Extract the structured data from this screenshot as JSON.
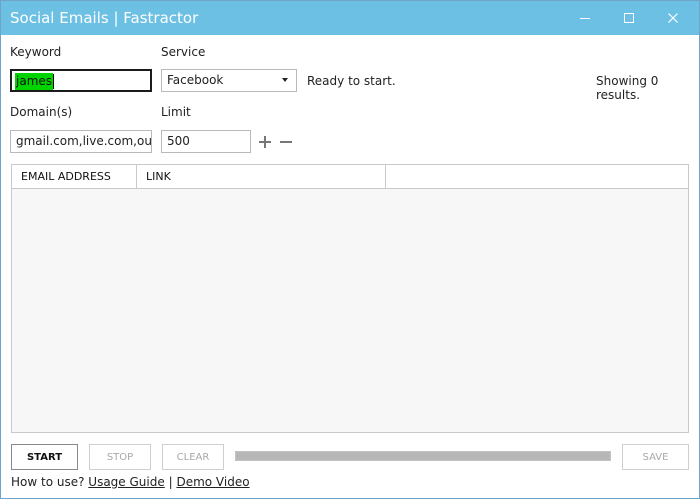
{
  "window": {
    "title": "Social Emails | Fastractor",
    "controls": {
      "minimize": "–",
      "maximize": "☐",
      "close": "✕"
    }
  },
  "form": {
    "keyword_label": "Keyword",
    "keyword_value": "james",
    "service_label": "Service",
    "service_value": "Facebook",
    "domains_label": "Domain(s)",
    "domains_value": "gmail.com,live.com,outlo",
    "limit_label": "Limit",
    "limit_value": "500"
  },
  "status": {
    "message": "Ready to start.",
    "results": "Showing 0 results."
  },
  "table": {
    "columns": [
      "EMAIL ADDRESS",
      "LINK",
      ""
    ],
    "rows": []
  },
  "buttons": {
    "start": "START",
    "stop": "STOP",
    "clear": "CLEAR",
    "save": "SAVE"
  },
  "progress": {
    "value": 1.0
  },
  "footer": {
    "prefix": "How to use?",
    "usage_guide": "Usage Guide",
    "separator": "|",
    "demo_video": "Demo Video"
  },
  "colors": {
    "titlebar": "#6cc0e3",
    "selection_highlight": "#00d400"
  }
}
